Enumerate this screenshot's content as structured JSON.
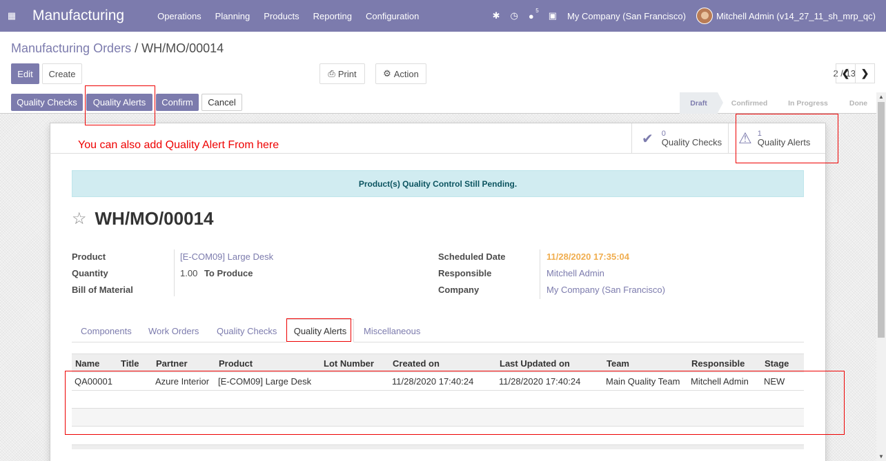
{
  "navbar": {
    "app_name": "Manufacturing",
    "menu": [
      "Operations",
      "Planning",
      "Products",
      "Reporting",
      "Configuration"
    ],
    "message_count": "5",
    "company": "My Company (San Francisco)",
    "user": "Mitchell Admin (v14_27_11_sh_mrp_qc)"
  },
  "breadcrumb": {
    "parent": "Manufacturing Orders",
    "separator": " / ",
    "current": "WH/MO/00014"
  },
  "toolbar": {
    "edit": "Edit",
    "create": "Create",
    "print": "Print",
    "action": "Action",
    "pager": "2 / 13"
  },
  "statusbar": {
    "buttons": [
      "Quality Checks",
      "Quality Alerts",
      "Confirm",
      "Cancel"
    ],
    "stages": [
      "Draft",
      "Confirmed",
      "In Progress",
      "Done"
    ],
    "active_stage": "Draft"
  },
  "smart_buttons": {
    "checks_count": "0",
    "checks_label": "Quality Checks",
    "alerts_count": "1",
    "alerts_label": "Quality Alerts"
  },
  "annotation": "You can also add Quality Alert From here",
  "alert_message": "Product(s) Quality Control Still Pending.",
  "record": {
    "name": "WH/MO/00014",
    "left_fields": [
      {
        "label": "Product",
        "value": "[E-COM09] Large Desk"
      },
      {
        "label": "Quantity",
        "value": "1.00",
        "suffix": "To Produce"
      },
      {
        "label": "Bill of Material",
        "value": ""
      }
    ],
    "right_fields": [
      {
        "label": "Scheduled Date",
        "value": "11/28/2020 17:35:04"
      },
      {
        "label": "Responsible",
        "value": "Mitchell Admin"
      },
      {
        "label": "Company",
        "value": "My Company (San Francisco)"
      }
    ]
  },
  "tabs": [
    "Components",
    "Work Orders",
    "Quality Checks",
    "Quality Alerts",
    "Miscellaneous"
  ],
  "active_tab": "Quality Alerts",
  "table": {
    "columns": [
      "Name",
      "Title",
      "Partner",
      "Product",
      "Lot Number",
      "Created on",
      "Last Updated on",
      "Team",
      "Responsible",
      "Stage"
    ],
    "rows": [
      [
        "QA00001",
        "",
        "Azure Interior",
        "[E-COM09] Large Desk",
        "",
        "11/28/2020 17:40:24",
        "11/28/2020 17:40:24",
        "Main Quality Team",
        "Mitchell Admin",
        "NEW"
      ]
    ]
  },
  "colors": {
    "brand": "#7c7bad",
    "annotation": "#e00000",
    "date_warning": "#f0ad4e",
    "info_bg": "#d1ecf1"
  }
}
